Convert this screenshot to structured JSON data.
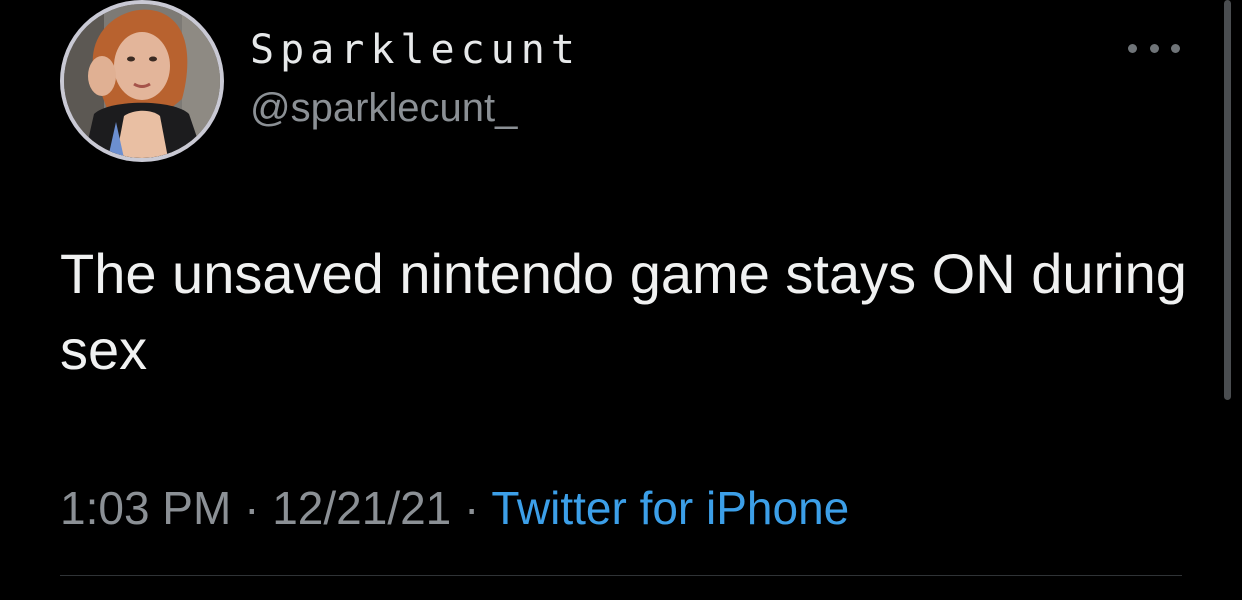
{
  "tweet": {
    "display_name": "Sparklecunt",
    "handle": "@sparklecunt_",
    "text": "The unsaved nintendo game stays ON during sex",
    "time": "1:03 PM",
    "separator": "·",
    "date": "12/21/21",
    "source": "Twitter for iPhone",
    "avatar_icon": "profile-photo",
    "more_icon": "more-options-icon"
  },
  "colors": {
    "background": "#000000",
    "primary_text": "#e7e9ea",
    "secondary_text": "#8b9095",
    "link": "#3c9fe8",
    "divider": "#2f3336"
  }
}
